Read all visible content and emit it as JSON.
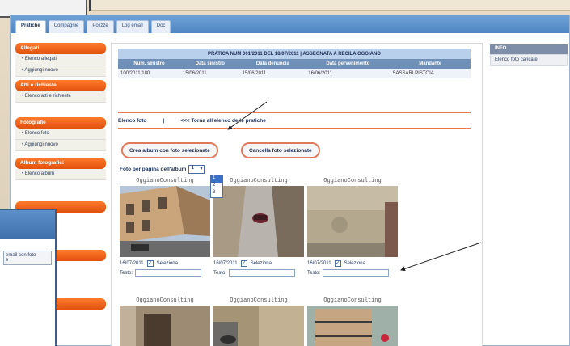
{
  "tabs": [
    "Pratiche",
    "Compagnie",
    "Polizze",
    "Log email",
    "Doc"
  ],
  "sidebar": {
    "sections": [
      {
        "title": "Allegati",
        "items": [
          "• Elenco allegati",
          "• Aggiungi nuovo"
        ]
      },
      {
        "title": "Atti e richieste",
        "items": [
          "• Elenco atti e richieste"
        ]
      },
      {
        "title": "Fotografie",
        "items": [
          "• Elenco foto",
          "• Aggiungi nuovo"
        ]
      },
      {
        "title": "Album fotografici",
        "items": [
          "• Elenco album"
        ]
      }
    ]
  },
  "pratica": {
    "title": "PRATICA NUM 001/2011 DEL 18/07/2011 | ASSEGNATA A RECILA OGGIANO",
    "columns": [
      "Num. sinistro",
      "Data sinistro",
      "Data denuncia",
      "Data pervenimento",
      "Mandante"
    ],
    "row": [
      "100/2011/180",
      "15/06/2011",
      "15/06/2011",
      "16/06/2011",
      "SASSARI PISTOIA"
    ]
  },
  "nav": {
    "label": "Elenco foto",
    "separator": "|",
    "back": "<<< Torna all'elenco delle pratiche"
  },
  "buttons": {
    "create_album": "Crea album con foto selezionate",
    "delete_photos": "Cancella foto selezionate"
  },
  "per_page": {
    "label": "Foto per pagina dell'album",
    "selected": "1",
    "options": [
      "1",
      "2",
      "3"
    ]
  },
  "photos": [
    {
      "watermark": "OggianoConsulting",
      "date": "16/07/2011",
      "select_label": "Seleziona",
      "checked": true,
      "text_label": "Testo:"
    },
    {
      "watermark": "OggianoConsulting",
      "date": "16/07/2011",
      "select_label": "Seleziona",
      "checked": true,
      "text_label": "Testo:"
    },
    {
      "watermark": "OggianoConsulting",
      "date": "16/07/2011",
      "select_label": "Seleziona",
      "checked": true,
      "text_label": "Testo:"
    },
    {
      "watermark": "OggianoConsulting"
    },
    {
      "watermark": "OggianoConsulting"
    },
    {
      "watermark": "OggianoConsulting"
    }
  ],
  "right_panel": {
    "header": "INFO",
    "item": "Elenco foto caricate"
  },
  "popup": {
    "line1": "email con foto",
    "line2": "e"
  },
  "colors": {
    "accent_orange": "#e1510e",
    "tab_blue": "#4f86c2",
    "header_blue": "#6e8fb8"
  }
}
